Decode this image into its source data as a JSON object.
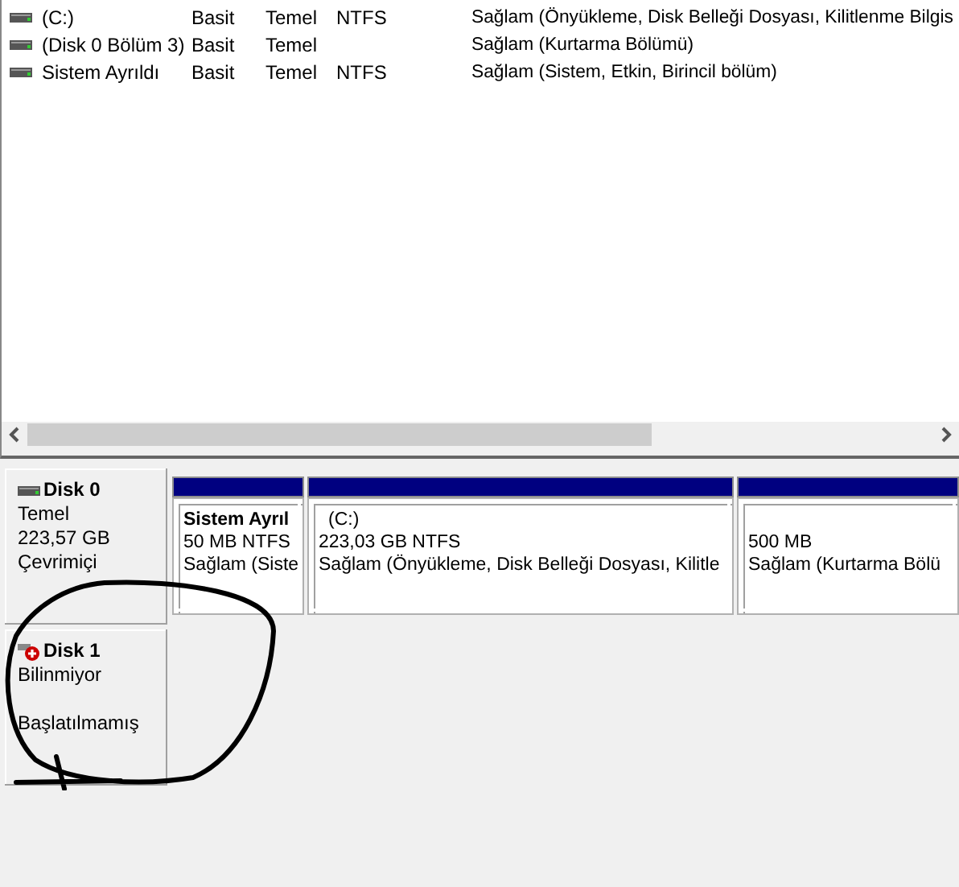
{
  "volumes": [
    {
      "name": "(C:)",
      "layout": "Basit",
      "type": "Temel",
      "file_system": "NTFS",
      "status": "Sağlam (Önyükleme, Disk Belleği Dosyası, Kilitlenme Bilgis"
    },
    {
      "name": "(Disk 0 Bölüm 3)",
      "layout": "Basit",
      "type": "Temel",
      "status": "Sağlam (Kurtarma Bölümü)"
    },
    {
      "name": "Sistem Ayrıldı",
      "layout": "Basit",
      "type": "Temel",
      "file_system": "NTFS",
      "status": "Sağlam (Sistem, Etkin, Birincil bölüm)"
    }
  ],
  "disks": [
    {
      "kind": "online",
      "name": "Disk 0",
      "type": "Temel",
      "size": "223,57 GB",
      "status": "Çevrimiçi",
      "partitions": [
        {
          "title": "Sistem Ayrıl",
          "size": "50 MB NTFS",
          "status": "Sağlam (Siste"
        },
        {
          "title": "(C:)",
          "size": "223,03 GB NTFS",
          "status": "Sağlam (Önyükleme, Disk Belleği Dosyası, Kilitle"
        },
        {
          "size": "500 MB",
          "status": "Sağlam (Kurtarma Bölü"
        }
      ]
    },
    {
      "kind": "error",
      "name": "Disk 1",
      "type": "Bilinmiyor",
      "status": "Başlatılmamış"
    }
  ]
}
